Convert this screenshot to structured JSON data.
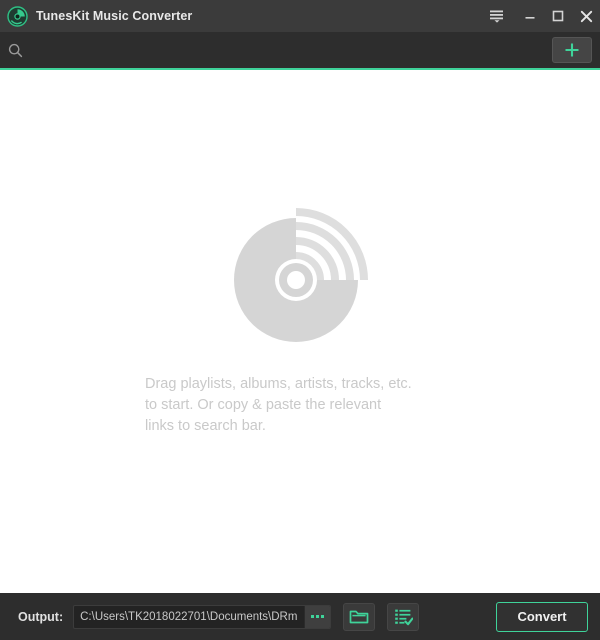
{
  "window": {
    "title": "TunesKit Music Converter",
    "logo_icon": "disc-logo-icon",
    "controls": {
      "menu": "menu-list-icon",
      "minimize": "minimize-icon",
      "maximize": "maximize-icon",
      "close": "close-icon"
    }
  },
  "search": {
    "icon": "search-icon",
    "value": "",
    "placeholder": "",
    "add_button_icon": "plus-icon",
    "accent_color": "#3fd39a"
  },
  "main": {
    "artwork_icon": "disc-with-signal-waves-icon",
    "hint_line1": "Drag playlists, albums, artists, tracks, etc.",
    "hint_line2": "to start. Or copy & paste the relevant",
    "hint_line3": "links to search bar."
  },
  "bottom": {
    "output_label": "Output:",
    "output_path": "C:\\Users\\TK2018022701\\Documents\\DRm",
    "browse_dots_label": "...",
    "open_folder_icon": "folder-icon",
    "converted_list_icon": "list-check-icon",
    "convert_label": "Convert"
  },
  "colors": {
    "titlebar": "#3b3b3b",
    "chrome": "#2d2d2d",
    "accent": "#3fd39a",
    "content_bg": "#ffffff",
    "hint_text": "#c9c9c9"
  }
}
